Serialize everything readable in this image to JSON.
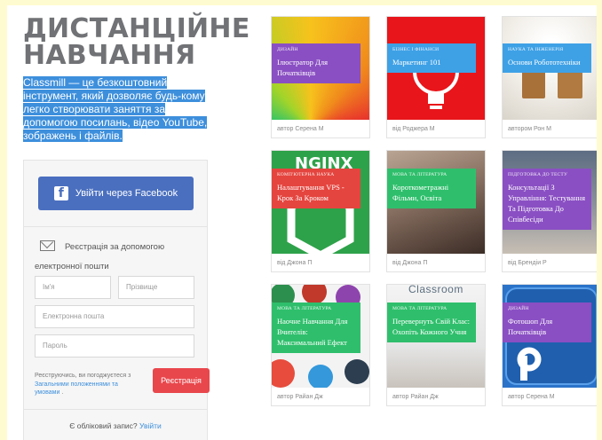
{
  "hero": {
    "title_line1": "ДИСТАНЦІЙНЕ",
    "title_line2": "НАВЧАННЯ",
    "description": "Classmill — це безкоштовний інструмент, який дозволяє будь-кому легко створювати заняття за допомогою посилань, відео YouTube, зображень і файлів."
  },
  "signup": {
    "facebook_label": "Увійти через Facebook",
    "email_heading": "Реєстрація за допомогою електронної пошти",
    "first_name_placeholder": "Ім'я",
    "last_name_placeholder": "Прізвище",
    "email_placeholder": "Електронна пошта",
    "password_placeholder": "Пароль",
    "legal_prefix": "Реєструючись, ви погоджуєтеся з",
    "legal_link": "Загальними положеннями та умовами",
    "legal_suffix": ".",
    "register_label": "Реєстрація",
    "have_account": "Є обліковий запис?",
    "login_link": "Увійти"
  },
  "colors": {
    "purple": "#8a4fc3",
    "blue": "#3ea1e6",
    "red": "#e5453f",
    "green": "#2fbf6c",
    "facebook": "#4a6fbf",
    "register": "#e8474c"
  },
  "cards": [
    {
      "category": "ДИЗАЙН",
      "title": "Ілюстратор Для Початківців",
      "author": "автор Серена М",
      "color": "#8a4fc3"
    },
    {
      "category": "БІЗНЕС І ФІНАНСИ",
      "title": "Маркетинг 101",
      "author": "від Роджера М",
      "color": "#3ea1e6"
    },
    {
      "category": "НАУКА ТА ІНЖЕНЕРІЯ",
      "title": "Основи Робототехніки",
      "author": "автором Рон М",
      "color": "#3ea1e6"
    },
    {
      "category": "КОМП'ЮТЕРНА НАУКА",
      "title": "Налаштування VPS - Крок За Кроком",
      "author": "від Джона П",
      "color": "#e5453f"
    },
    {
      "category": "МОВА ТА ЛІТЕРАТУРА",
      "title": "Короткометражні Фільми, Освіта",
      "author": "від Джона П",
      "color": "#2fbf6c"
    },
    {
      "category": "ПІДГОТОВКА ДО ТЕСТУ",
      "title": "Консультації З Управління: Тестування Та Підготовка До Співбесіди",
      "author": "від Брендіи Р",
      "color": "#8a4fc3"
    },
    {
      "category": "МОВА ТА ЛІТЕРАТУРА",
      "title": "Наочне Навчання Для Вчителів: Максимальний Ефект",
      "author": "автор Райан Дж",
      "color": "#2fbf6c"
    },
    {
      "category": "МОВА ТА ЛІТЕРАТУРА",
      "title": "Перевернуть Свій Клас: Охопіть Кожного Учня",
      "author": "автор Райан Дж",
      "color": "#2fbf6c"
    },
    {
      "category": "ДИЗАЙН",
      "title": "Фотошоп Для Початківців",
      "author": "автор Серена М",
      "color": "#8a4fc3"
    }
  ],
  "thumb_text": {
    "nginx": "NGINX",
    "classroom": "Classroom"
  }
}
